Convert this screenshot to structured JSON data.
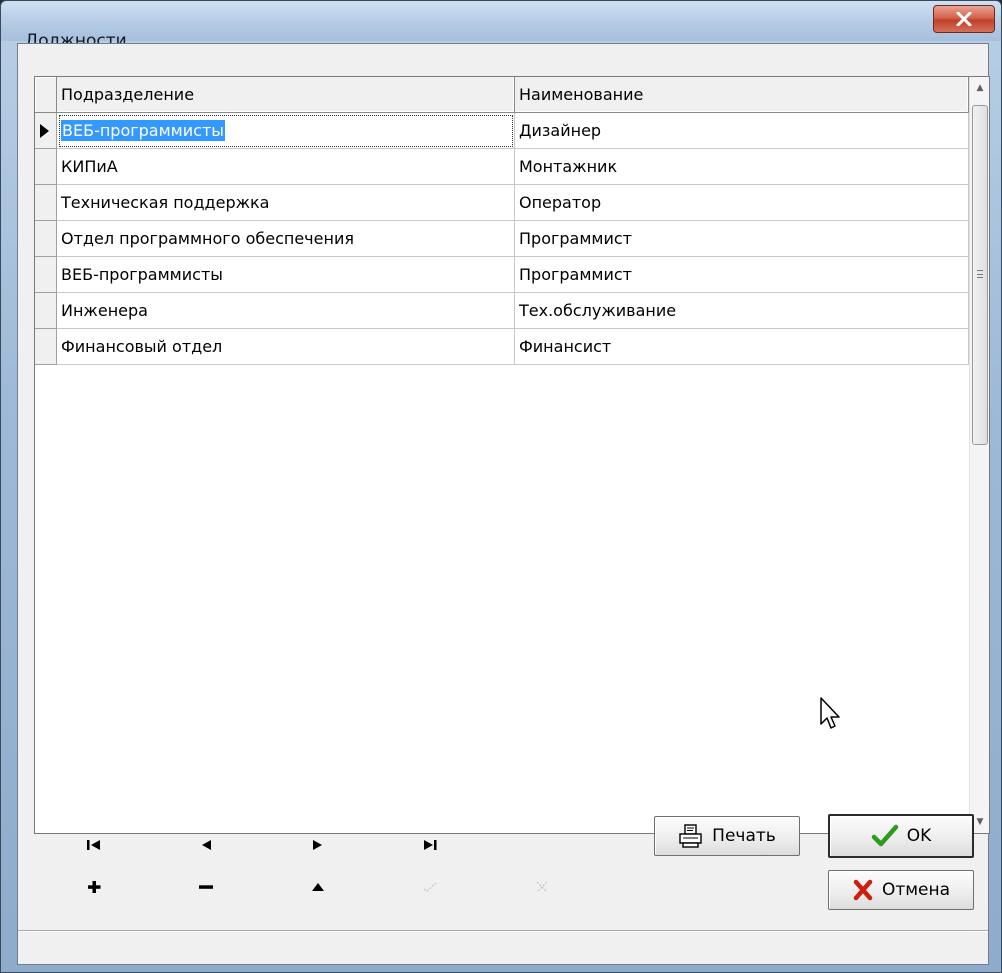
{
  "window": {
    "title": "Должности"
  },
  "grid": {
    "columns": [
      "Подразделение",
      "Наименование"
    ],
    "rows": [
      {
        "department": "ВЕБ-программисты",
        "name": "Дизайнер",
        "selected": true
      },
      {
        "department": "КИПиА",
        "name": "Монтажник"
      },
      {
        "department": "Техническая поддержка",
        "name": "Оператор"
      },
      {
        "department": "Отдел программного обеспечения",
        "name": "Программист"
      },
      {
        "department": "ВЕБ-программисты",
        "name": "Программист"
      },
      {
        "department": "Инженера",
        "name": "Тех.обслуживание"
      },
      {
        "department": "Финансовый отдел",
        "name": "Финансист"
      }
    ]
  },
  "navigator": {
    "buttons": [
      {
        "name": "first-record",
        "icon": "skip-first-icon",
        "enabled": true
      },
      {
        "name": "prior-record",
        "icon": "triangle-left-icon",
        "enabled": true
      },
      {
        "name": "next-record",
        "icon": "triangle-right-icon",
        "enabled": true
      },
      {
        "name": "last-record",
        "icon": "skip-last-icon",
        "enabled": true
      },
      {
        "name": "insert-record",
        "icon": "plus-icon",
        "enabled": true
      },
      {
        "name": "delete-record",
        "icon": "minus-icon",
        "enabled": true
      },
      {
        "name": "edit-record",
        "icon": "triangle-up-icon",
        "enabled": true
      },
      {
        "name": "post-record",
        "icon": "check-icon",
        "enabled": false
      },
      {
        "name": "cancel-record",
        "icon": "x-icon",
        "enabled": false
      }
    ]
  },
  "actions": {
    "print_label": "Печать",
    "ok_label": "OK",
    "cancel_label": "Отмена"
  },
  "colors": {
    "selection": "#3399ff",
    "ok_check": "#2e9a1e",
    "cancel_x": "#cc1f10"
  }
}
